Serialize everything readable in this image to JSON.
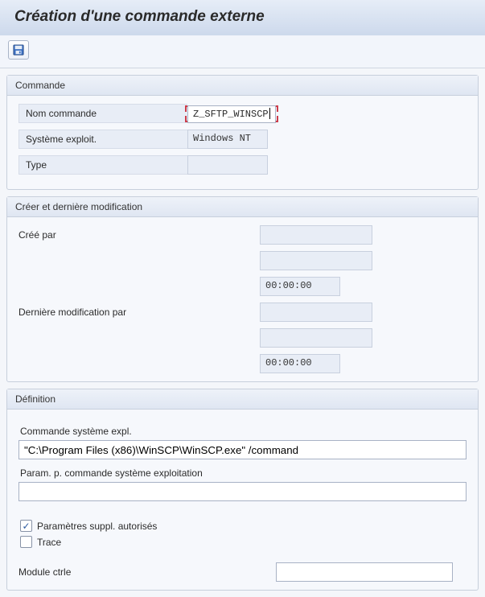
{
  "title": "Création d'une commande externe",
  "toolbar": {
    "save_icon": "save"
  },
  "commande": {
    "group_title": "Commande",
    "nom_label": "Nom commande",
    "nom_value": "Z_SFTP_WINSCP",
    "sys_label": "Système exploit.",
    "sys_value": "Windows NT",
    "type_label": "Type",
    "type_value": ""
  },
  "modif": {
    "group_title": "Créer et dernière modification",
    "cree_label": "Créé par",
    "cree_user": "",
    "cree_date": "",
    "cree_time": "00:00:00",
    "modif_label": "Dernière modification par",
    "modif_user": "",
    "modif_date": "",
    "modif_time": "00:00:00"
  },
  "definition": {
    "group_title": "Définition",
    "cmd_label": "Commande système expl.",
    "cmd_value": "\"C:\\Program Files (x86)\\WinSCP\\WinSCP.exe\" /command",
    "param_label": "Param. p. commande système exploitation",
    "param_value": "",
    "chk_extra_label": "Paramètres suppl. autorisés",
    "chk_extra_checked": true,
    "chk_trace_label": "Trace",
    "chk_trace_checked": false,
    "module_label": "Module ctrle",
    "module_value": ""
  }
}
